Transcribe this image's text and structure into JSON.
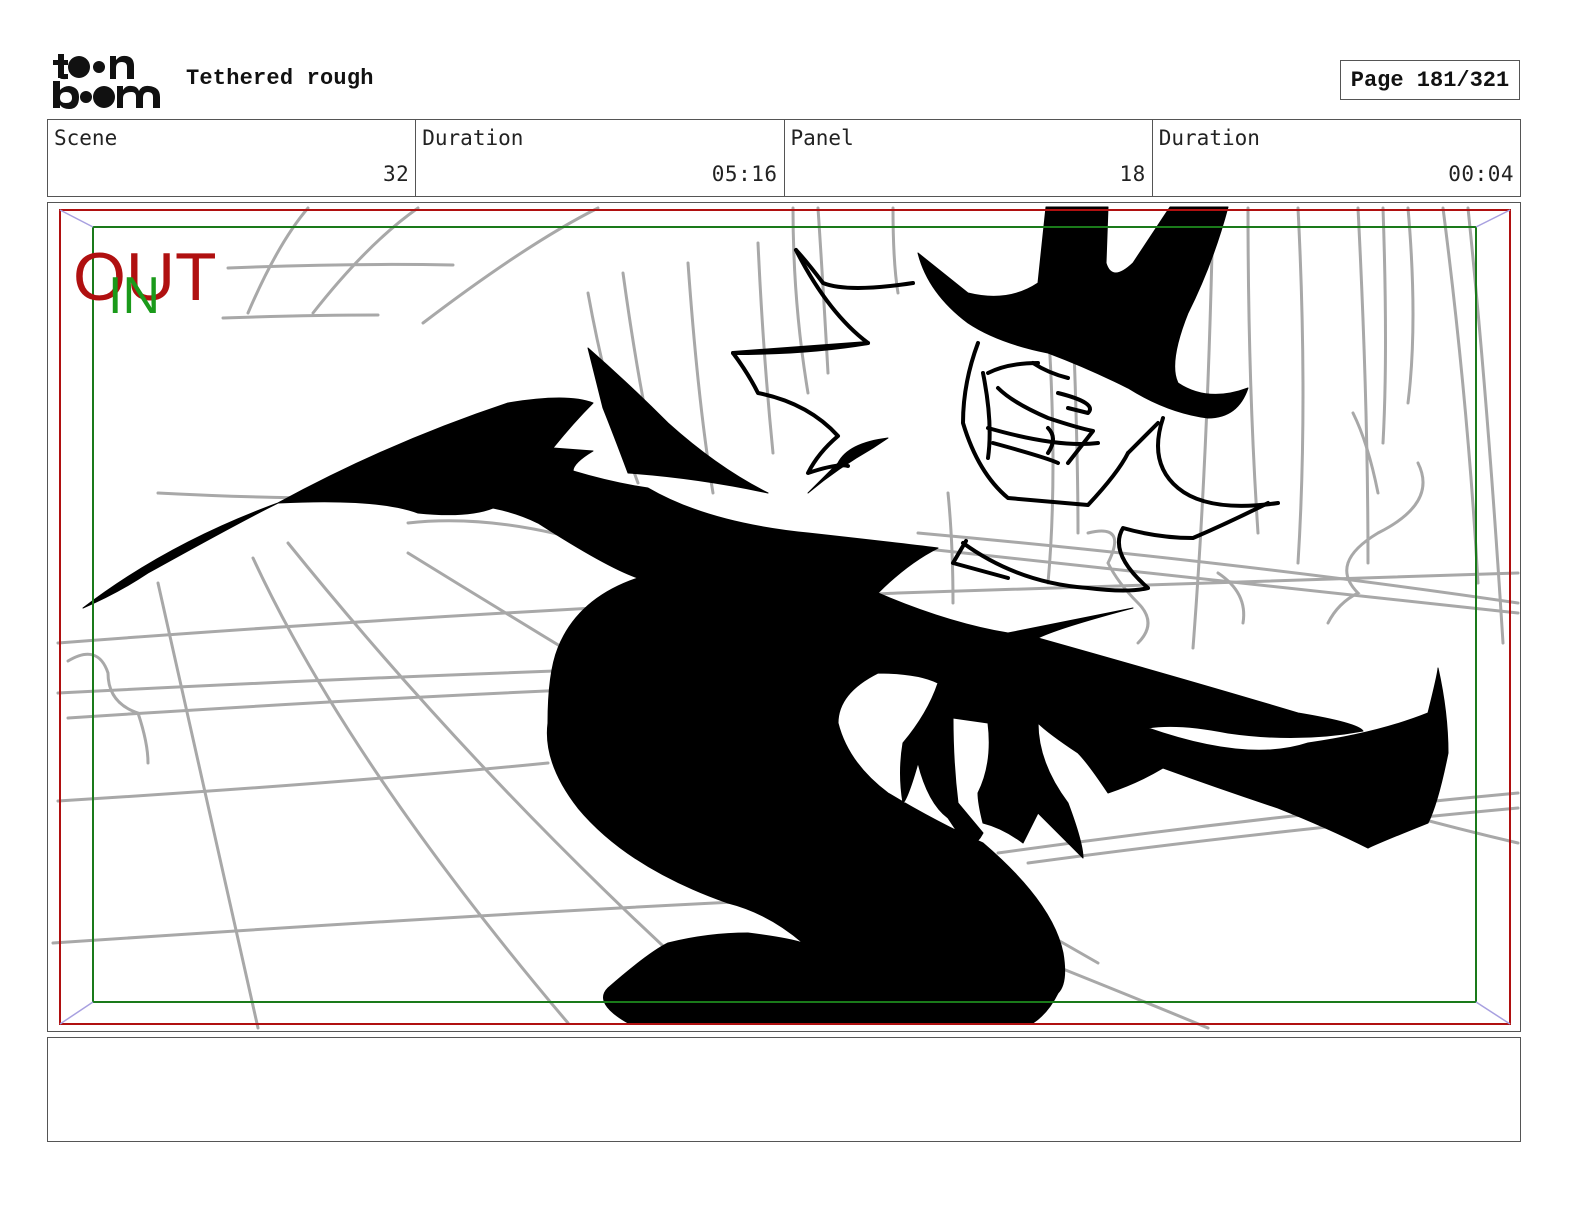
{
  "header": {
    "logo_icon": "toon-boom-logo-icon",
    "title": "Tethered rough",
    "page": "Page 181/321"
  },
  "info": [
    {
      "label": "Scene",
      "value": "32"
    },
    {
      "label": "Duration",
      "value": "05:16"
    },
    {
      "label": "Panel",
      "value": "18"
    },
    {
      "label": "Duration",
      "value": "00:04"
    }
  ],
  "panel": {
    "safe_frame_out_label": "OUT",
    "safe_frame_in_label": "IN",
    "out_color": "#b01010",
    "in_color": "#1a9a1a"
  },
  "notes": {
    "text": ""
  }
}
